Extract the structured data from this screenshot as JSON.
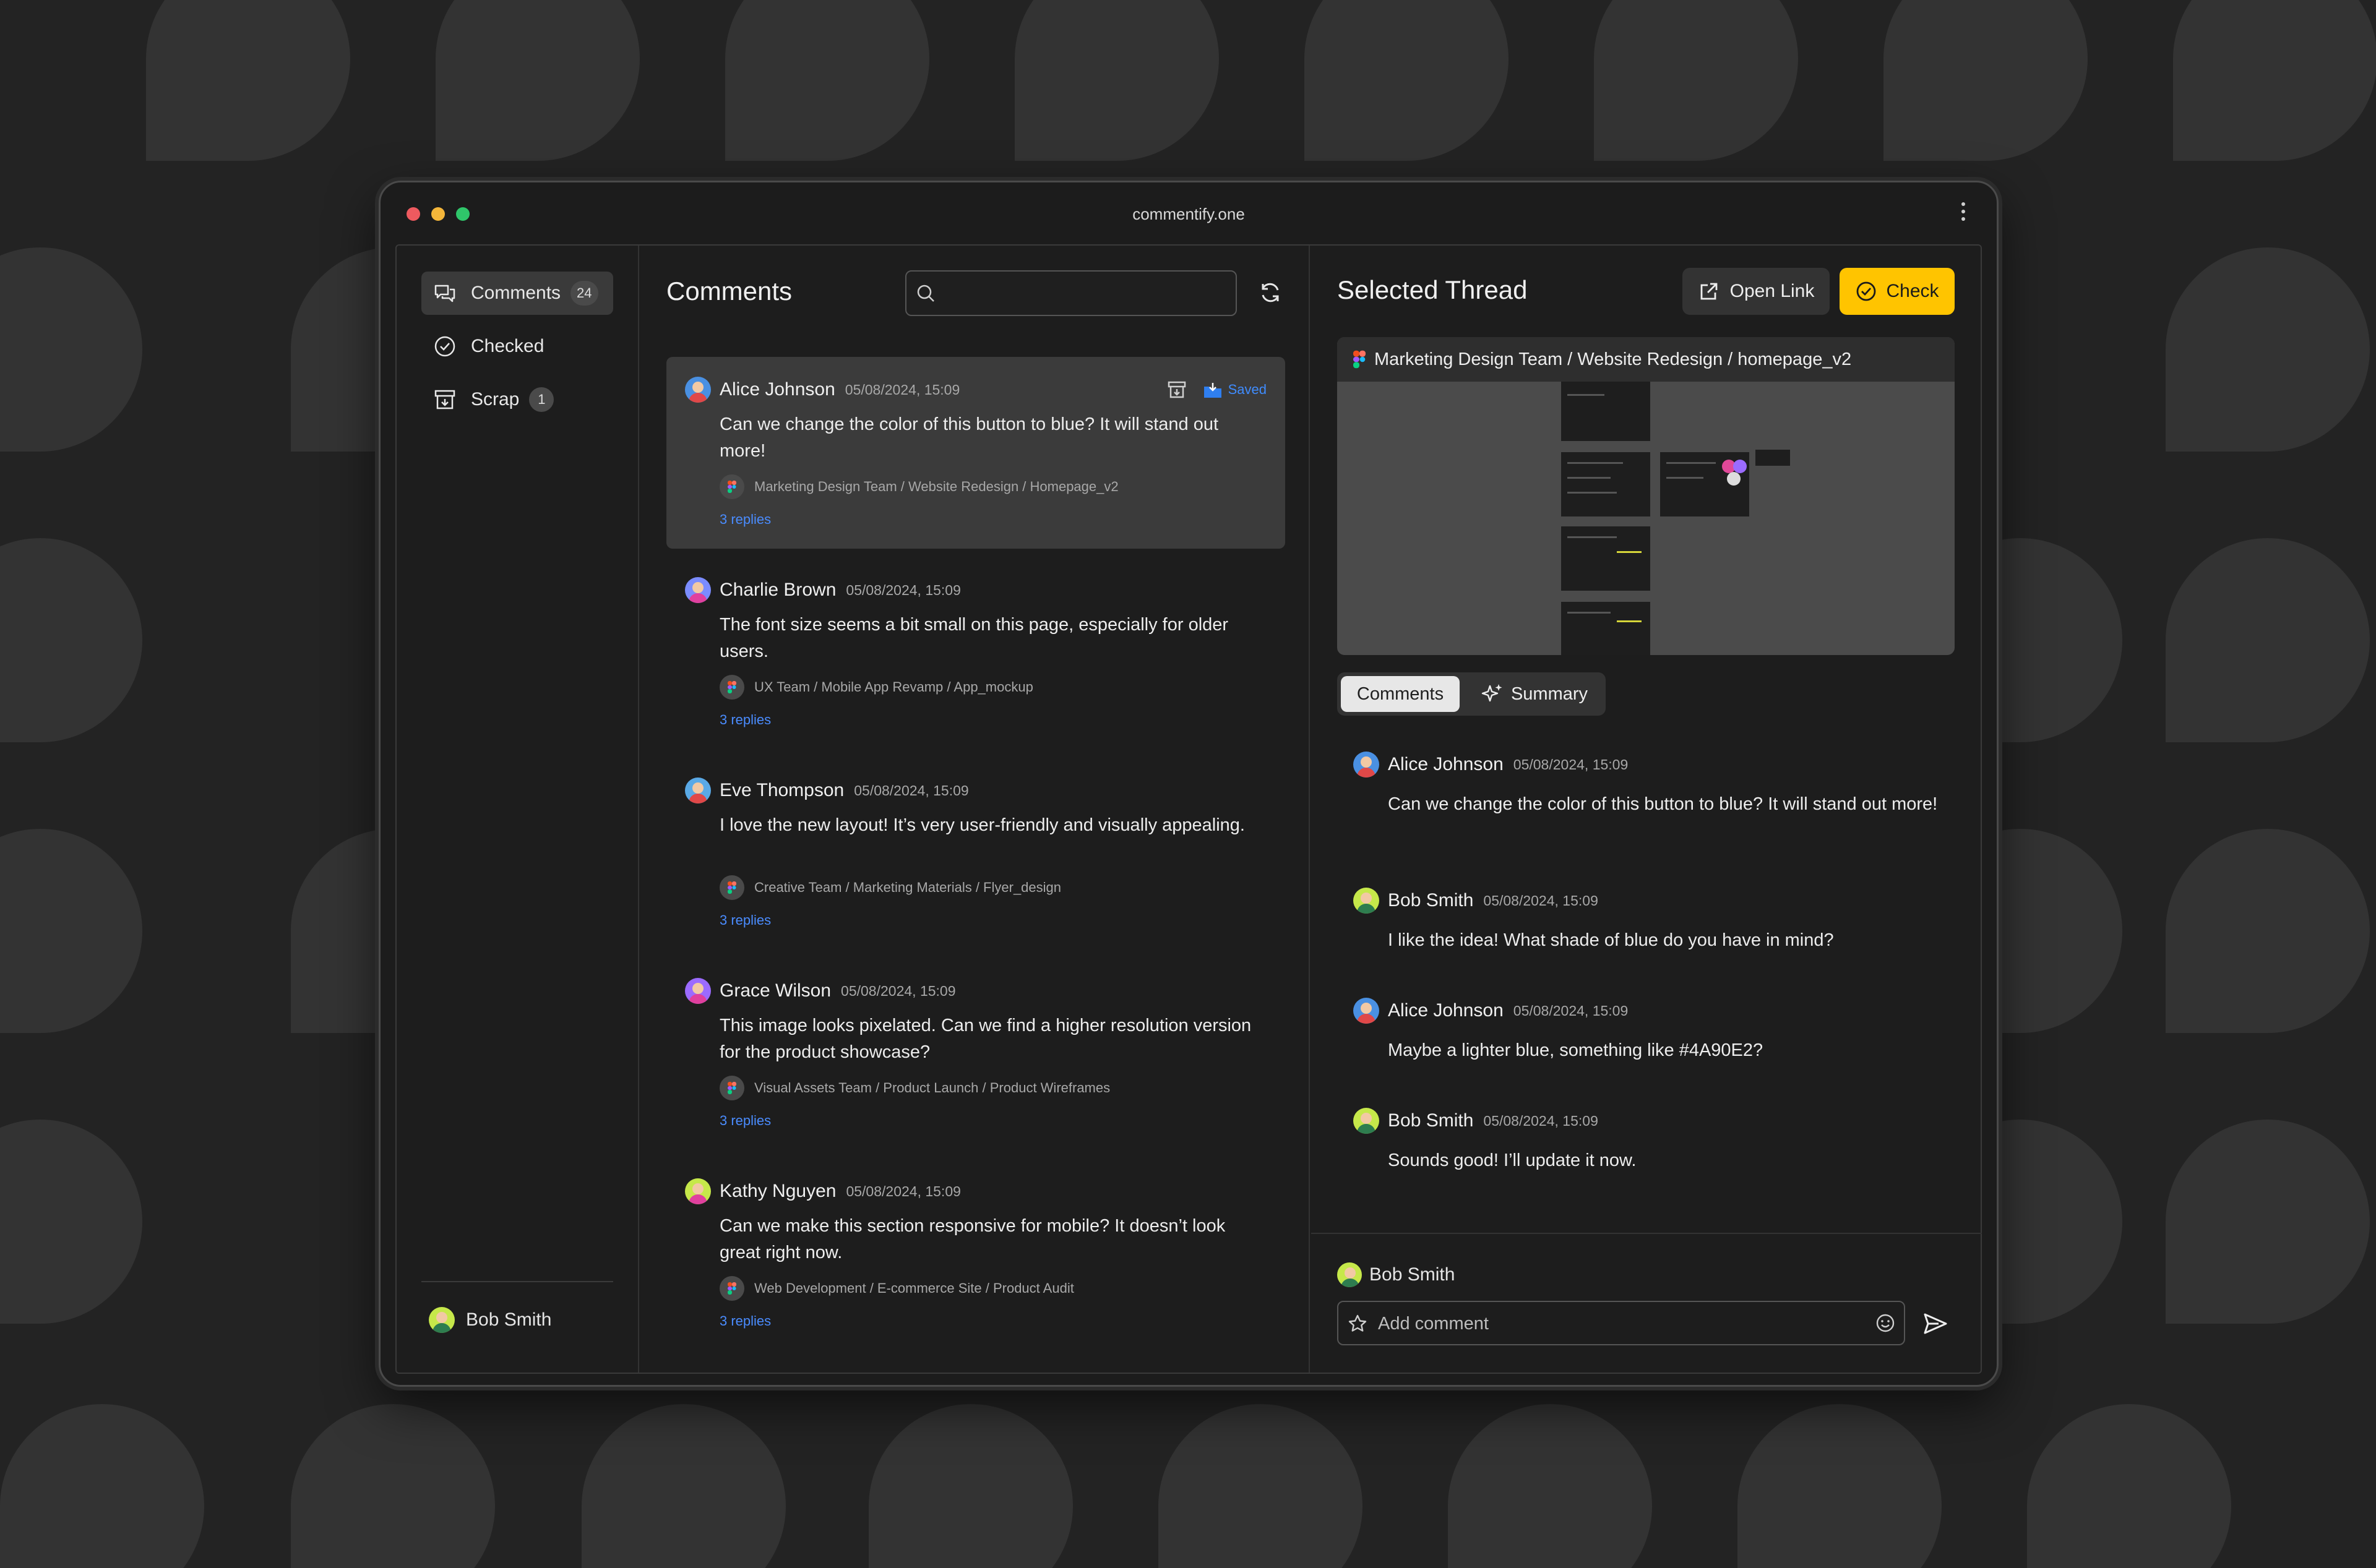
{
  "window": {
    "url": "commentify.one"
  },
  "sidebar": {
    "items": [
      {
        "label": "Comments",
        "count": "24",
        "icon": "comments-icon",
        "active": true
      },
      {
        "label": "Checked",
        "count": "",
        "icon": "check-circle-icon",
        "active": false
      },
      {
        "label": "Scrap",
        "count": "1",
        "icon": "archive-icon",
        "active": false
      }
    ],
    "user": {
      "name": "Bob Smith"
    }
  },
  "list": {
    "title": "Comments",
    "search_placeholder": "",
    "items": [
      {
        "author": "Alice Johnson",
        "time": "05/08/2024, 15:09",
        "text": "Can we change the color of this button to blue? It will stand out more!",
        "path": "Marketing Design Team / Website Redesign / Homepage_v2",
        "replies": "3 replies",
        "saved_label": "Saved",
        "avatar_color": "#4a90e2"
      },
      {
        "author": "Charlie Brown",
        "time": "05/08/2024, 15:09",
        "text": "The font size seems a bit small on this page, especially for older users.",
        "path": "UX Team / Mobile App Revamp / App_mockup",
        "replies": "3 replies",
        "avatar_color": "#7b8cff"
      },
      {
        "author": "Eve Thompson",
        "time": "05/08/2024, 15:09",
        "text": "I love the new layout! It’s very user-friendly and visually appealing.",
        "path": "Creative Team / Marketing Materials / Flyer_design",
        "replies": "3 replies",
        "avatar_color": "#5aa9e6"
      },
      {
        "author": "Grace Wilson",
        "time": "05/08/2024, 15:09",
        "text": "This image looks pixelated. Can we find a higher resolution version for the product showcase?",
        "path": "Visual Assets Team / Product Launch / Product Wireframes",
        "replies": "3 replies",
        "avatar_color": "#9b6bff"
      },
      {
        "author": "Kathy Nguyen",
        "time": "05/08/2024, 15:09",
        "text": "Can we make this section responsive for mobile? It doesn’t look great right now.",
        "path": "Web Development / E-commerce Site / Product Audit",
        "replies": "3 replies",
        "avatar_color": "#c6e84a"
      }
    ]
  },
  "thread": {
    "title": "Selected Thread",
    "open_link_label": "Open Link",
    "check_label": "Check",
    "preview_path": "Marketing Design Team / Website Redesign / homepage_v2",
    "tabs": {
      "comments": "Comments",
      "summary": "Summary"
    },
    "replies": [
      {
        "author": "Alice Johnson",
        "time": "05/08/2024, 15:09",
        "text": "Can we change the color of this button to blue? It will stand out more!",
        "avatar_color": "#4a90e2"
      },
      {
        "author": "Bob Smith",
        "time": "05/08/2024, 15:09",
        "text": "I like the idea! What shade of blue do you have in mind?",
        "avatar_color": "#c6e84a"
      },
      {
        "author": "Alice Johnson",
        "time": "05/08/2024, 15:09",
        "text": "Maybe a lighter blue, something like #4A90E2?",
        "avatar_color": "#4a90e2"
      },
      {
        "author": "Bob Smith",
        "time": "05/08/2024, 15:09",
        "text": "Sounds good! I’ll update it now.",
        "avatar_color": "#c6e84a"
      }
    ],
    "composer": {
      "user": "Bob Smith",
      "placeholder": "Add comment"
    }
  },
  "colors": {
    "accent": "#ffc400",
    "link": "#4a8cff",
    "background": "#232323"
  }
}
